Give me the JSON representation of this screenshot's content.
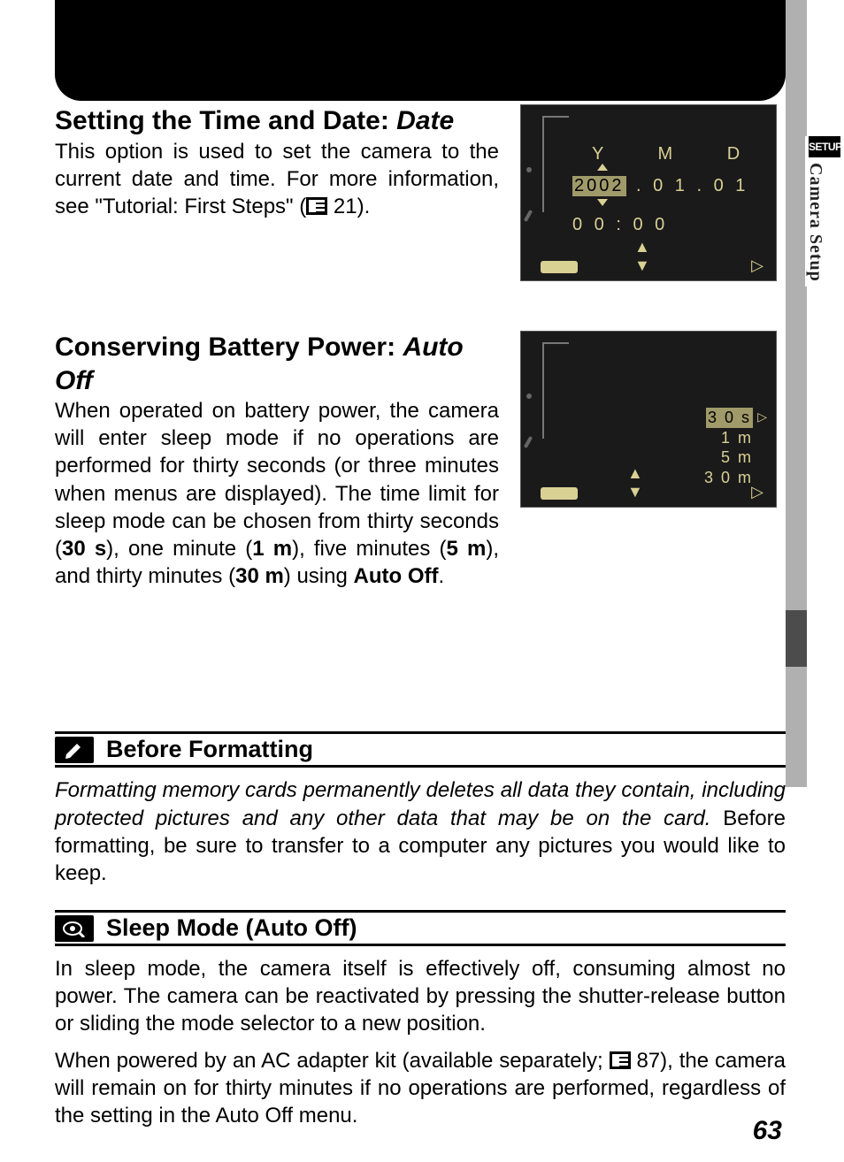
{
  "side_tab": {
    "setup": "SETUP",
    "section": "Camera Setup"
  },
  "heading_date": {
    "prefix": "Setting the Time and Date: ",
    "em": "Date"
  },
  "body_date_1": "This option is used to set the camera to the current date and time.  For more information, see \"Tutorial: First Steps\" (",
  "body_date_ref": " 21).",
  "heading_autooff": {
    "prefix": "Conserving Battery Power: ",
    "em": "Auto Off"
  },
  "body_autooff": {
    "p1": "When operated on battery power, the camera will enter sleep mode if no operations are performed for thirty seconds (or three minutes when menus are displayed).  The time limit for sleep mode can be chosen from thirty seconds (",
    "b1": "30 s",
    "p2": "), one minute (",
    "b2": "1 m",
    "p3": "), five minutes (",
    "b3": "5 m",
    "p4": "), and thirty minutes (",
    "b4": "30 m",
    "p5": ") using ",
    "b5": "Auto Off",
    "p6": "."
  },
  "camera_date": {
    "ymd": "Y   M   D",
    "year": "2002",
    "rest": ". 0 1 . 0 1",
    "time": "0 0 : 0 0"
  },
  "camera_autooff": {
    "items": [
      "3 0 s",
      "1 m",
      "5 m",
      "3 0 m"
    ],
    "selected": 0
  },
  "note1": {
    "title": "Before Formatting",
    "body_it": "Formatting memory cards permanently deletes all data they contain, including protected pictures and any other data that may be on the card.",
    "body_rest": "  Before formatting, be sure to transfer to a computer any pictures you would like to keep."
  },
  "note2": {
    "title": "Sleep Mode (Auto Off)",
    "p1": "In sleep mode, the camera itself is effectively off, consuming almost no power. The camera can be reactivated by pressing the shutter-release button or sliding the mode selector to a new position.",
    "p2a": "When powered by an AC adapter kit (available separately; ",
    "p2ref": " 87), the camera will remain on for thirty minutes if no operations are performed, regardless of the setting in the ",
    "p2b": "Auto Off",
    "p2c": " menu."
  },
  "page_number": "63"
}
